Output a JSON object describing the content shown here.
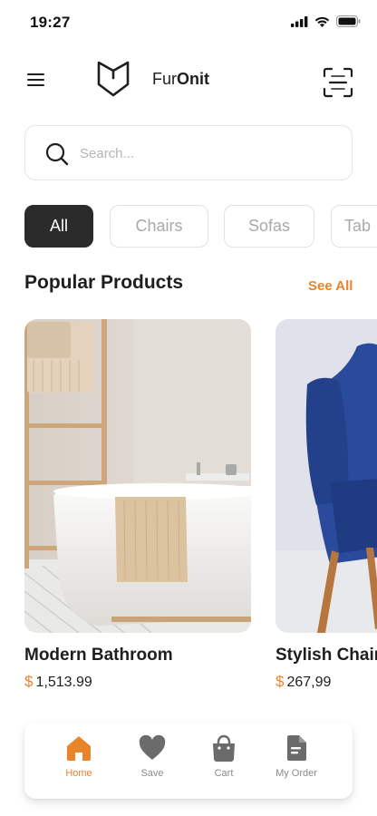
{
  "status_bar": {
    "time": "19:27"
  },
  "header": {
    "brand_regular": "Fur",
    "brand_bold": "Onit"
  },
  "search": {
    "placeholder": "Search..."
  },
  "categories": [
    {
      "label": "All",
      "active": true
    },
    {
      "label": "Chairs",
      "active": false
    },
    {
      "label": "Sofas",
      "active": false
    },
    {
      "label": "Tab",
      "active": false
    }
  ],
  "popular": {
    "title": "Popular Products",
    "see_all": "See All"
  },
  "products": [
    {
      "name": "Modern Bathroom",
      "currency": "$",
      "price": "1,513.99"
    },
    {
      "name": "Stylish Chair",
      "currency": "$",
      "price": "267,99"
    }
  ],
  "bottom_nav": [
    {
      "label": "Home",
      "active": true
    },
    {
      "label": "Save",
      "active": false
    },
    {
      "label": "Cart",
      "active": false
    },
    {
      "label": "My Order",
      "active": false
    }
  ],
  "colors": {
    "accent": "#e8842b",
    "dark": "#2b2b2b",
    "muted": "#a9a9a9",
    "chair_blue": "#2a4a9b"
  },
  "icons": {
    "menu": "hamburger-icon",
    "logo": "shield-logo-icon",
    "scan": "scan-icon",
    "search": "search-icon",
    "home": "home-icon",
    "save": "heart-icon",
    "cart": "shopping-bag-icon",
    "order": "document-icon"
  }
}
